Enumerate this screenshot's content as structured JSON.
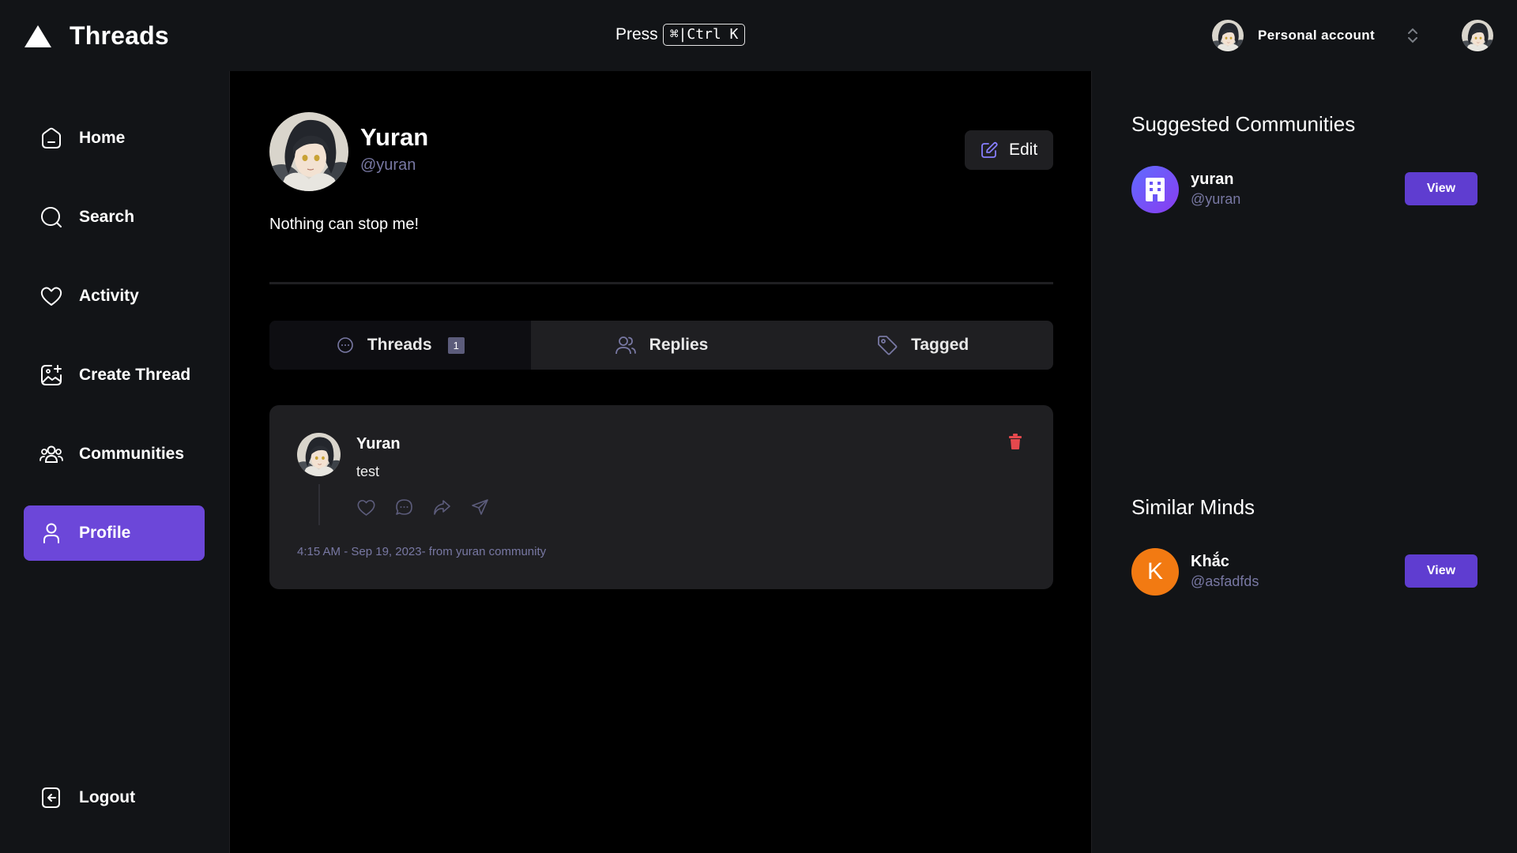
{
  "app": {
    "name": "Threads"
  },
  "topbar": {
    "press_label": "Press",
    "shortcut": "⌘|Ctrl K",
    "account_label": "Personal account"
  },
  "sidebar": {
    "items": [
      {
        "label": "Home",
        "icon": "home-icon"
      },
      {
        "label": "Search",
        "icon": "search-icon"
      },
      {
        "label": "Activity",
        "icon": "heart-icon"
      },
      {
        "label": "Create Thread",
        "icon": "create-image-icon"
      },
      {
        "label": "Communities",
        "icon": "communities-icon"
      },
      {
        "label": "Profile",
        "icon": "user-icon",
        "active": true
      }
    ],
    "logout_label": "Logout"
  },
  "profile": {
    "name": "Yuran",
    "handle": "@yuran",
    "bio": "Nothing can stop me!",
    "edit_label": "Edit"
  },
  "tabs": [
    {
      "label": "Threads",
      "icon": "chat-bubble-icon",
      "count": "1",
      "active": true
    },
    {
      "label": "Replies",
      "icon": "members-icon"
    },
    {
      "label": "Tagged",
      "icon": "tag-icon"
    }
  ],
  "thread": {
    "author": "Yuran",
    "text": "test",
    "meta": "4:15 AM - Sep 19, 2023- from yuran community",
    "actions": [
      "heart-icon",
      "reply-icon",
      "repost-icon",
      "share-icon"
    ]
  },
  "suggested": {
    "heading": "Suggested Communities",
    "items": [
      {
        "name": "yuran",
        "handle": "@yuran",
        "button": "View"
      }
    ]
  },
  "similar": {
    "heading": "Similar Minds",
    "items": [
      {
        "name": "Khắc",
        "handle": "@asfadfds",
        "initial": "K",
        "button": "View"
      }
    ]
  },
  "colors": {
    "accent": "#6C47D9",
    "button": "#5F3DD0",
    "muted": "#7878A3",
    "danger": "#E5484D",
    "orange": "#F27A12"
  }
}
